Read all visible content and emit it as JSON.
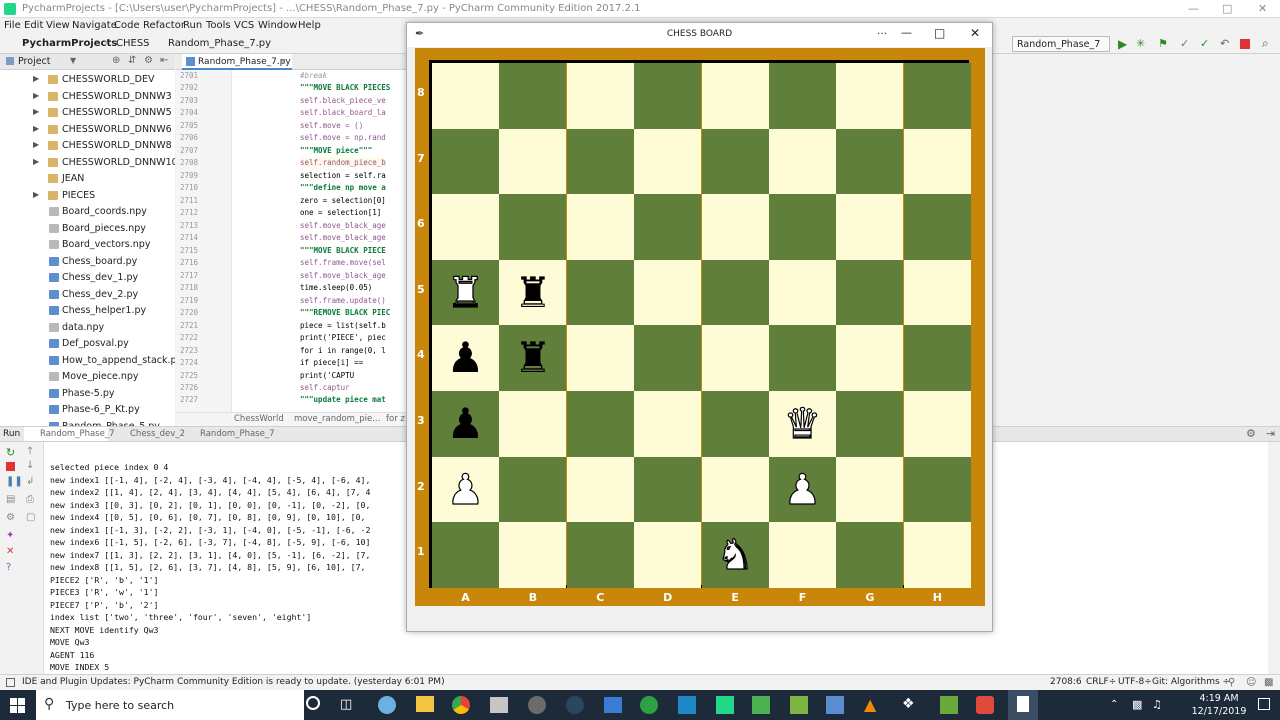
{
  "window": {
    "title": "PycharmProjects - [C:\\Users\\user\\PycharmProjects] - ...\\CHESS\\Random_Phase_7.py - PyCharm Community Edition 2017.2.1"
  },
  "menu": [
    "File",
    "Edit",
    "View",
    "Navigate",
    "Code",
    "Refactor",
    "Run",
    "Tools",
    "VCS",
    "Window",
    "Help"
  ],
  "breadcrumb": [
    "PycharmProjects",
    "CHESS",
    "Random_Phase_7.py"
  ],
  "run_config": "Random_Phase_7",
  "project_panel": {
    "header": "Project",
    "items": [
      {
        "label": "CHESSWORLD_DEV",
        "type": "folder"
      },
      {
        "label": "CHESSWORLD_DNNW3",
        "type": "folder"
      },
      {
        "label": "CHESSWORLD_DNNW5",
        "type": "folder"
      },
      {
        "label": "CHESSWORLD_DNNW6",
        "type": "folder"
      },
      {
        "label": "CHESSWORLD_DNNW8",
        "type": "folder"
      },
      {
        "label": "CHESSWORLD_DNNW10",
        "type": "folder"
      },
      {
        "label": "JEAN",
        "type": "folder-plain"
      },
      {
        "label": "PIECES",
        "type": "folder"
      },
      {
        "label": "Board_coords.npy",
        "type": "npy"
      },
      {
        "label": "Board_pieces.npy",
        "type": "npy"
      },
      {
        "label": "Board_vectors.npy",
        "type": "npy"
      },
      {
        "label": "Chess_board.py",
        "type": "py"
      },
      {
        "label": "Chess_dev_1.py",
        "type": "py"
      },
      {
        "label": "Chess_dev_2.py",
        "type": "py"
      },
      {
        "label": "Chess_helper1.py",
        "type": "py"
      },
      {
        "label": "data.npy",
        "type": "npy"
      },
      {
        "label": "Def_posval.py",
        "type": "py"
      },
      {
        "label": "How_to_append_stack.py",
        "type": "py"
      },
      {
        "label": "Move_piece.npy",
        "type": "npy"
      },
      {
        "label": "Phase-5.py",
        "type": "py"
      },
      {
        "label": "Phase-6_P_Kt.py",
        "type": "py"
      },
      {
        "label": "Random_Phase_5.py",
        "type": "py"
      }
    ]
  },
  "editor": {
    "tab": "Random_Phase_7.py",
    "lines": [
      {
        "n": "2701",
        "code": "        #break"
      },
      {
        "n": "2702",
        "code": "\"\"\"MOVE BLACK PIECES"
      },
      {
        "n": "2703",
        "code": "self.black_piece_ve"
      },
      {
        "n": "2704",
        "code": "self.black_board_la"
      },
      {
        "n": "2705",
        "code": "self.move = ()"
      },
      {
        "n": "2706",
        "code": "self.move = np.rand"
      },
      {
        "n": "2707",
        "code": "\"\"\"MOVE piece\"\"\""
      },
      {
        "n": "2708",
        "code": "self.random_piece_b"
      },
      {
        "n": "2709",
        "code": "selection = self.ra"
      },
      {
        "n": "2710",
        "code": "\"\"\"define np move a"
      },
      {
        "n": "2711",
        "code": "zero = selection[0]"
      },
      {
        "n": "2712",
        "code": "one = selection[1] "
      },
      {
        "n": "2713",
        "code": "self.move_black_age"
      },
      {
        "n": "2714",
        "code": "self.move_black_age"
      },
      {
        "n": "2715",
        "code": "\"\"\"MOVE BLACK PIECE"
      },
      {
        "n": "2716",
        "code": "self.frame.move(sel"
      },
      {
        "n": "2717",
        "code": "self.move_black_age"
      },
      {
        "n": "2718",
        "code": "time.sleep(0.05)"
      },
      {
        "n": "2719",
        "code": "self.frame.update()"
      },
      {
        "n": "2720",
        "code": "\"\"\"REMOVE BLACK PIEC"
      },
      {
        "n": "2721",
        "code": "piece = list(self.b"
      },
      {
        "n": "2722",
        "code": "print('PIECE', piec"
      },
      {
        "n": "2723",
        "code": "for i in range(0, l"
      },
      {
        "n": "2724",
        "code": "    if piece[i] == "
      },
      {
        "n": "2725",
        "code": "        print('CAPTU"
      },
      {
        "n": "2726",
        "code": "        self.captur"
      },
      {
        "n": "2727",
        "code": "\"\"\"update piece mat"
      }
    ],
    "crumb": [
      "ChessWorld",
      "move_random_pie...",
      "for z"
    ]
  },
  "run_panel": {
    "label": "Run",
    "tabs": [
      "Random_Phase_7",
      "Chess_dev_2",
      "Random_Phase_7"
    ],
    "console": [
      "selected piece index 0 4",
      "new index1 [[-1, 4], [-2, 4], [-3, 4], [-4, 4], [-5, 4], [-6, 4],",
      "new index2 [[1, 4], [2, 4], [3, 4], [4, 4], [5, 4], [6, 4], [7, 4",
      "new index3 [[0, 3], [0, 2], [0, 1], [0, 0], [0, -1], [0, -2], [0,",
      "new index4 [[0, 5], [0, 6], [0, 7], [0, 8], [0, 9], [0, 10], [0,",
      "new index1 [[-1, 3], [-2, 2], [-3, 1], [-4, 0], [-5, -1], [-6, -2",
      "new index6 [[-1, 5], [-2, 6], [-3, 7], [-4, 8], [-5, 9], [-6, 10]",
      "new index7 [[1, 3], [2, 2], [3, 1], [4, 0], [5, -1], [6, -2], [7,",
      "new index8 [[1, 5], [2, 6], [3, 7], [4, 8], [5, 9], [6, 10], [7,",
      "PIECE2 ['R', 'b', '1']",
      "PIECE3 ['R', 'w', '1']",
      "PIECE7 ['P', 'b', '2']",
      "index list ['two', 'three', 'four', 'seven', 'eight']",
      "NEXT MOVE identify Qw3",
      "MOVE Qw3",
      "AGENT 116",
      "MOVE INDEX 5"
    ]
  },
  "status": {
    "message": "IDE and Plugin Updates: PyCharm Community Edition is ready to update. (yesterday 6:01 PM)",
    "position": "2708:6",
    "line_sep": "CRLF÷",
    "encoding": "UTF-8÷",
    "git": "Git: Algorithms ÷"
  },
  "chess_window": {
    "title": "CHESS BOARD",
    "files": [
      "A",
      "B",
      "C",
      "D",
      "E",
      "F",
      "G",
      "H"
    ],
    "ranks": [
      "8",
      "7",
      "6",
      "5",
      "4",
      "3",
      "2",
      "1"
    ],
    "pieces": [
      {
        "square": "A5",
        "glyph": "♜",
        "color": "white",
        "name": "white-rook"
      },
      {
        "square": "B5",
        "glyph": "♜",
        "color": "black",
        "name": "black-rook"
      },
      {
        "square": "A4",
        "glyph": "♟",
        "color": "black",
        "name": "black-pawn"
      },
      {
        "square": "B4",
        "glyph": "♜",
        "color": "black",
        "name": "black-rook"
      },
      {
        "square": "A3",
        "glyph": "♟",
        "color": "black",
        "name": "black-pawn"
      },
      {
        "square": "F3",
        "glyph": "♛",
        "color": "white",
        "name": "white-queen"
      },
      {
        "square": "A2",
        "glyph": "♟",
        "color": "white",
        "name": "white-pawn"
      },
      {
        "square": "F2",
        "glyph": "♟",
        "color": "white",
        "name": "white-pawn"
      },
      {
        "square": "E1",
        "glyph": "♞",
        "color": "white",
        "name": "white-knight"
      }
    ]
  },
  "taskbar": {
    "search_placeholder": "Type here to search",
    "time": "4:19 AM",
    "date": "12/17/2019"
  }
}
